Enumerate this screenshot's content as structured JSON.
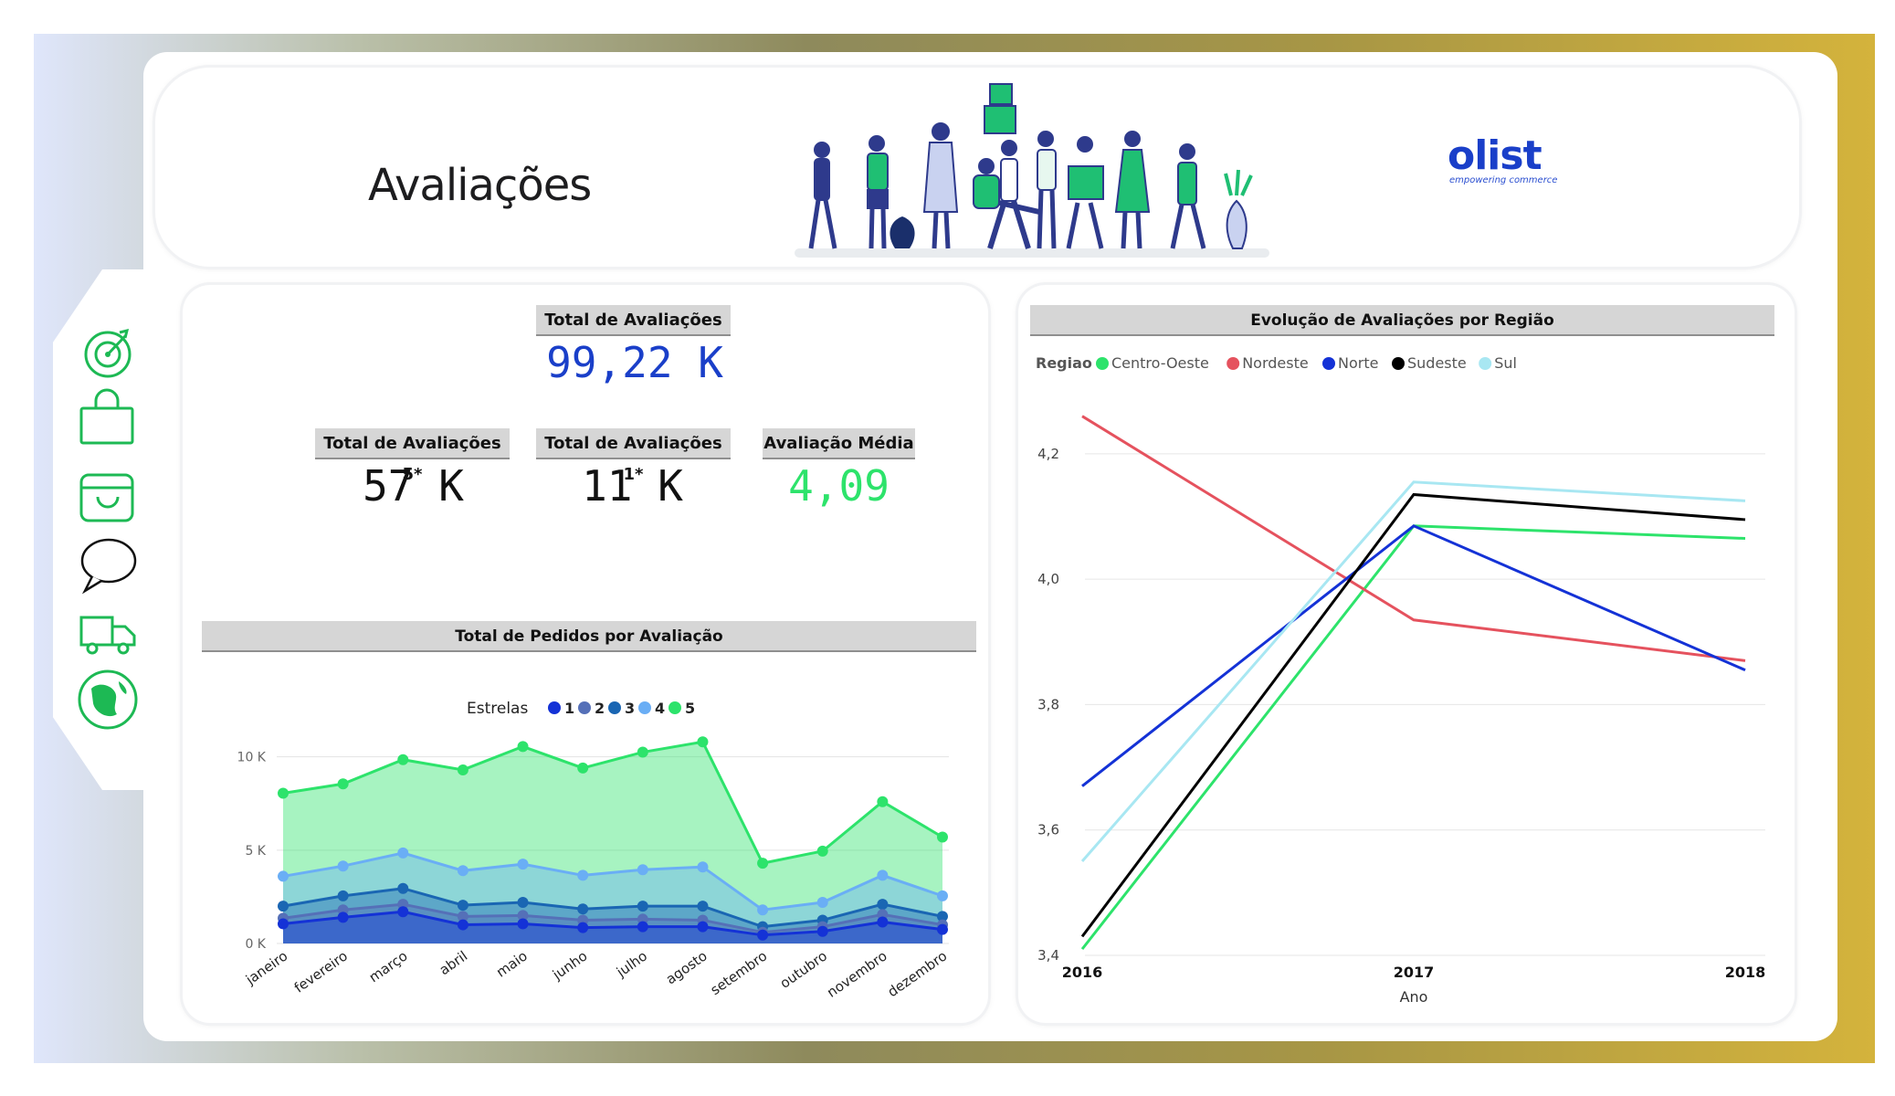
{
  "header": {
    "title": "Avaliações",
    "brand": "olist",
    "tagline": "empowering commerce"
  },
  "nav": {
    "icons": [
      "target-icon",
      "shopping-bag-icon",
      "store-icon",
      "chat-bubble-icon",
      "truck-icon",
      "globe-icon"
    ],
    "active": "globe-icon",
    "accent": "#1db954"
  },
  "kpis": {
    "total": {
      "label": "Total de Avaliações",
      "value": "99,22 K",
      "color": "#1a3fc9"
    },
    "five_star": {
      "label": "Total de Avaliações 5*",
      "value": "57 K",
      "color": "#111111"
    },
    "one_star": {
      "label": "Total de Avaliações 1*",
      "value": "11 K",
      "color": "#111111"
    },
    "average": {
      "label": "Avaliação Média",
      "value": "4,09",
      "color": "#2de36b"
    }
  },
  "chart_data": [
    {
      "type": "area",
      "title": "Total de Pedidos por Avaliação",
      "legend_title": "Estrelas",
      "legend_position": "top-center",
      "categories": [
        "janeiro",
        "fevereiro",
        "março",
        "abril",
        "maio",
        "junho",
        "julho",
        "agosto",
        "setembro",
        "outubro",
        "novembro",
        "dezembro"
      ],
      "y_ticks": [
        {
          "value": 0,
          "label": "0 K"
        },
        {
          "value": 5000,
          "label": "5 K"
        },
        {
          "value": 10000,
          "label": "10 K"
        }
      ],
      "ylim": [
        0,
        11500
      ],
      "series": [
        {
          "name": "1",
          "color": "#1432d6",
          "values": [
            1050,
            1400,
            1700,
            1000,
            1050,
            850,
            900,
            900,
            450,
            650,
            1150,
            750
          ]
        },
        {
          "name": "2",
          "color": "#5570b8",
          "values": [
            1350,
            1800,
            2100,
            1450,
            1500,
            1250,
            1300,
            1250,
            600,
            900,
            1550,
            1000
          ]
        },
        {
          "name": "3",
          "color": "#1a66b3",
          "values": [
            2000,
            2550,
            2950,
            2050,
            2200,
            1850,
            2000,
            2000,
            900,
            1250,
            2100,
            1450
          ]
        },
        {
          "name": "4",
          "color": "#6aaef5",
          "values": [
            3600,
            4150,
            4850,
            3900,
            4250,
            3650,
            3950,
            4100,
            1800,
            2200,
            3650,
            2550
          ]
        },
        {
          "name": "5",
          "color": "#2de36b",
          "values": [
            8050,
            8550,
            9850,
            9300,
            10550,
            9400,
            10250,
            10800,
            4300,
            4950,
            7600,
            5700
          ]
        }
      ]
    },
    {
      "type": "line",
      "title": "Evolução de Avaliações por Região",
      "legend_title": "Regiao",
      "legend_position": "top-left",
      "xlabel": "Ano",
      "x": [
        "2016",
        "2017",
        "2018"
      ],
      "y_ticks": [
        {
          "value": 3.4,
          "label": "3,4"
        },
        {
          "value": 3.6,
          "label": "3,6"
        },
        {
          "value": 3.8,
          "label": "3,8"
        },
        {
          "value": 4.0,
          "label": "4,0"
        },
        {
          "value": 4.2,
          "label": "4,2"
        }
      ],
      "ylim": [
        3.4,
        4.21
      ],
      "grid": true,
      "series": [
        {
          "name": "Centro-Oeste",
          "color": "#2de36b",
          "values": [
            3.41,
            4.085,
            4.065
          ]
        },
        {
          "name": "Nordeste",
          "color": "#e5525e",
          "values": [
            4.26,
            3.935,
            3.87
          ]
        },
        {
          "name": "Norte",
          "color": "#1432d6",
          "values": [
            3.67,
            4.085,
            3.855
          ]
        },
        {
          "name": "Sudeste",
          "color": "#000000",
          "values": [
            3.43,
            4.135,
            4.095
          ]
        },
        {
          "name": "Sul",
          "color": "#a8e7f2",
          "values": [
            3.55,
            4.155,
            4.125
          ]
        }
      ]
    }
  ]
}
